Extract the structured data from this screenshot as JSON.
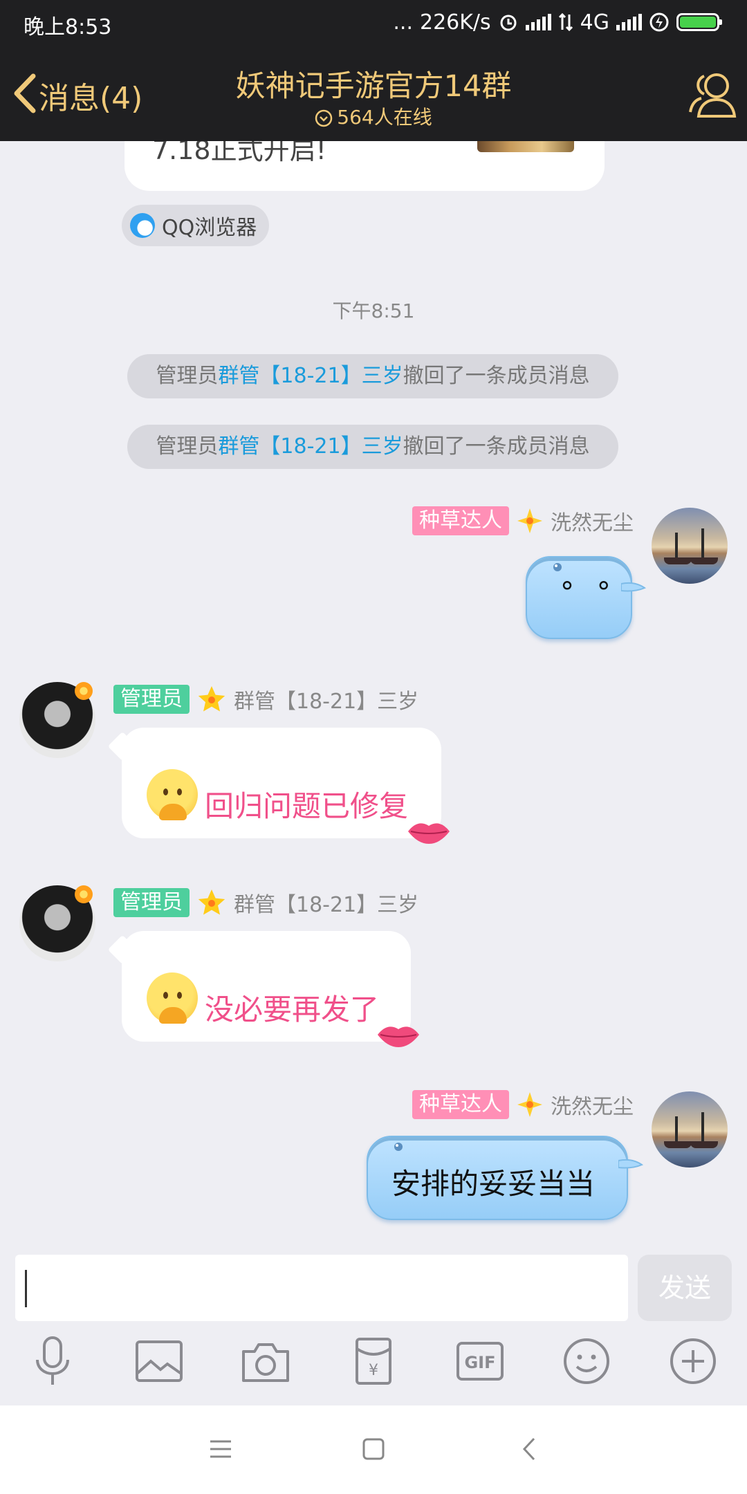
{
  "status_bar": {
    "time": "晚上8:53",
    "dots": "...",
    "speed": "226K/s",
    "network": "4G"
  },
  "header": {
    "back_label": "消息(4)",
    "title": "妖神记手游官方14群",
    "online": "564人在线"
  },
  "chat": {
    "card": {
      "text": "7.18正式开启!",
      "source": "QQ浏览器"
    },
    "timestamp": "下午8:51",
    "notices": [
      {
        "prefix": "管理员",
        "name": "群管【18-21】三岁",
        "suffix": "撤回了一条成员消息"
      },
      {
        "prefix": "管理员",
        "name": "群管【18-21】三岁",
        "suffix": "撤回了一条成员消息"
      }
    ],
    "messages": [
      {
        "side": "right",
        "badge": "种草达人",
        "sender": "洗然无尘",
        "text": "° °"
      },
      {
        "side": "left",
        "badge": "管理员",
        "sender": "群管【18-21】三岁",
        "text": "回归问题已修复"
      },
      {
        "side": "left",
        "badge": "管理员",
        "sender": "群管【18-21】三岁",
        "text": "没必要再发了"
      },
      {
        "side": "right",
        "badge": "种草达人",
        "sender": "洗然无尘",
        "text": "安排的妥妥当当"
      }
    ]
  },
  "input": {
    "value": "",
    "send_label": "发送"
  },
  "colors": {
    "header_bg": "#1f1f21",
    "header_accent": "#f0c979",
    "chat_bg": "#eeeef3",
    "highlight_blue": "#1a9bdb",
    "message_pink": "#f0508a",
    "badge_pink": "#ff8fb6",
    "badge_green": "#4ecf9d",
    "bubble_blue": "#a9d8fb"
  },
  "toolbar_icons": [
    "microphone-icon",
    "image-icon",
    "camera-icon",
    "red-packet-icon",
    "gif-icon",
    "emoji-icon",
    "plus-icon"
  ],
  "nav_icons": [
    "menu-icon",
    "home-icon",
    "back-icon"
  ]
}
